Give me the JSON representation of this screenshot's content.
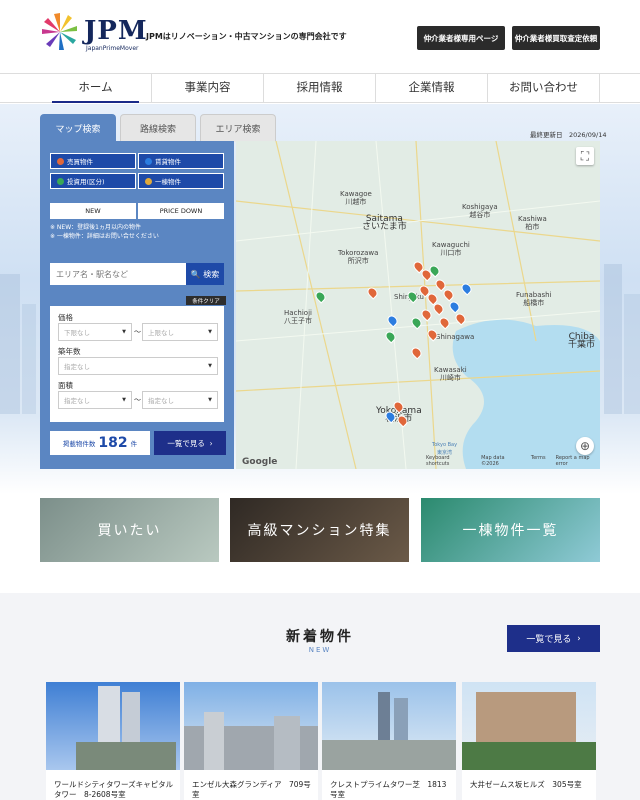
{
  "header": {
    "logo_text": "JPM",
    "logo_sub": "JapanPrimeMover",
    "tagline": "JPMはリノベーション・中古マンションの専門会社です",
    "btn_agent_page": "仲介業者様専用ページ",
    "btn_agent_request": "仲介業者様買取査定依頼"
  },
  "nav": [
    "ホーム",
    "事業内容",
    "採用情報",
    "企業情報",
    "お問い合わせ"
  ],
  "search": {
    "tabs": [
      "マップ検索",
      "路線検索",
      "エリア検索"
    ],
    "updated": "最終更新日　2026/09/14",
    "categories": [
      "売買物件",
      "賃貸物件",
      "投資用(区分)",
      "一棟物件"
    ],
    "category_colors": [
      "#e0673a",
      "#2c7de0",
      "#3aa757",
      "#e0a93a"
    ],
    "btn_new": "NEW",
    "btn_price_down": "PRICE DOWN",
    "note1": "※ NEW：登録後1ヵ月以内の物件",
    "note2": "※ 一棟物件：詳細はお問い合せください",
    "placeholder": "エリア名・駅名など",
    "search_btn": "検索",
    "clear_btn": "条件クリア",
    "price_label": "価格",
    "price_min": "下限なし",
    "price_max": "上限なし",
    "age_label": "築年数",
    "age_val": "指定なし",
    "area_label": "面積",
    "area_min": "指定なし",
    "area_max": "指定なし",
    "tilde": "～",
    "count_prefix": "掲載物件数",
    "count": "182",
    "count_suffix": "件",
    "list_btn": "一覧で見る"
  },
  "map": {
    "labels": [
      "Kawagoe\n川越市",
      "Saitama\nさいたま市",
      "Koshigaya\n越谷市",
      "Kashiwa\n柏市",
      "Tokorozawa\n所沢市",
      "Kawaguchi\n川口市",
      "Funabashi\n船橋市",
      "Hachioji\n八王子市",
      "Chiba\n千葉市",
      "Kawasaki\n川崎市",
      "Yokohama\n横浜市",
      "Tokyo Bay\n東京湾",
      "Shinjuku",
      "Shinagawa"
    ],
    "google": "Google",
    "footer": [
      "Keyboard shortcuts",
      "Map data ©2026",
      "Terms",
      "Report a map error"
    ]
  },
  "banners": [
    "買いたい",
    "高級マンション特集",
    "一棟物件一覧"
  ],
  "news": {
    "title": "新着物件",
    "sub": "NEW",
    "btn": "一覧で見る",
    "cards": [
      "ワールドシティタワーズキャピタルタワー　8-2608号室",
      "エンゼル大森グランディア　709号室",
      "クレストプライムタワー芝　1813号室",
      "大井ゼームス坂ヒルズ　305号室"
    ]
  }
}
